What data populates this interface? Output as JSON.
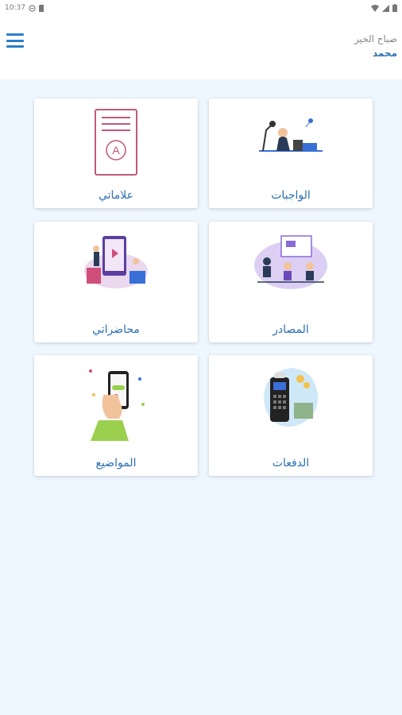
{
  "status_bar": {
    "time": "10:37"
  },
  "header": {
    "greeting": "صباح الخير",
    "user_name": "محمد"
  },
  "cards": [
    {
      "id": "homework",
      "label": "الواجبات",
      "icon": "desk-study-illustration"
    },
    {
      "id": "grades",
      "label": "علاماتي",
      "icon": "graded-paper-illustration"
    },
    {
      "id": "resources",
      "label": "المصادر",
      "icon": "classroom-illustration"
    },
    {
      "id": "lectures",
      "label": "محاضراتي",
      "icon": "online-lecture-illustration"
    },
    {
      "id": "payments",
      "label": "الدفعات",
      "icon": "card-terminal-illustration"
    },
    {
      "id": "topics",
      "label": "المواضيع",
      "icon": "phone-hand-illustration"
    }
  ],
  "colors": {
    "accent": "#2b6fb5",
    "background": "#eef6ff"
  }
}
